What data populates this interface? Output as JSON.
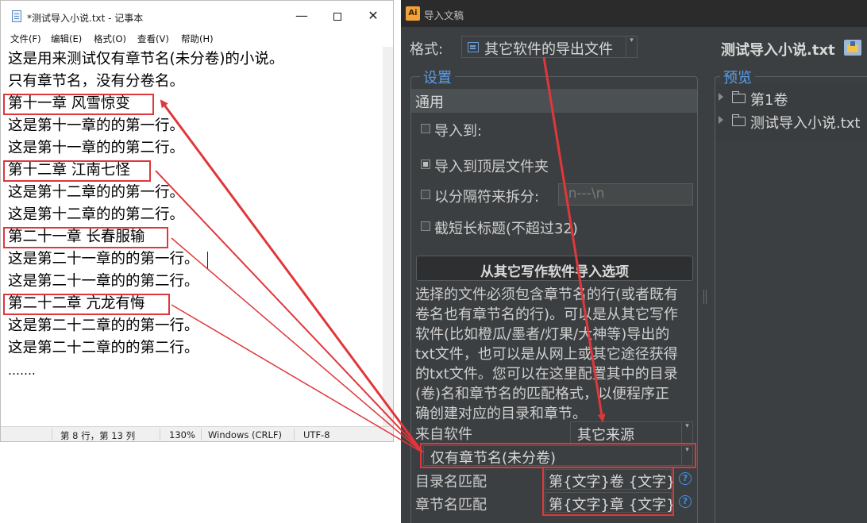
{
  "notepad": {
    "title": "*测试导入小说.txt - 记事本",
    "window_controls": {
      "minimize": "—",
      "close": "✕"
    },
    "menu": [
      "文件(F)",
      "编辑(E)",
      "格式(O)",
      "查看(V)",
      "帮助(H)"
    ],
    "lines": [
      "这是用来测试仅有章节名(未分卷)的小说。",
      "只有章节名，没有分卷名。",
      "第十一章 风雪惊变",
      "这是第十一章的的第一行。",
      "这是第十一章的的第二行。",
      "第十二章 江南七怪",
      "这是第十二章的的第一行。",
      "这是第十二章的的第二行。",
      "第二十一章 长春服输",
      "这是第二十一章的的第一行。",
      "这是第二十一章的的第二行。",
      "第二十二章 亢龙有悔",
      "这是第二十二章的的第一行。",
      "这是第二十二章的的第二行。",
      "……."
    ],
    "status": {
      "position": "第 8 行，第 13 列",
      "zoom": "130%",
      "line_ending": "Windows (CRLF)",
      "encoding": "UTF-8"
    }
  },
  "import_dialog": {
    "app_icon": "Ai",
    "title": "导入文稿",
    "format_label": "格式:",
    "format_value": "其它软件的导出文件",
    "settings_legend": "设置",
    "tab_general": "通用",
    "import_to_label": "导入到:",
    "import_top_label": "导入到顶层文件夹",
    "split_label": "以分隔符来拆分:",
    "split_placeholder": "\\n---\\n",
    "truncate_label": "截短长标题(不超过32)",
    "checkboxes": {
      "import_to": false,
      "import_top": true,
      "split": false,
      "truncate": false
    },
    "other_software_button": "从其它写作软件导入选项",
    "description_lines": [
      "选择的文件必须包含章节名的行(或者既有",
      "卷名也有章节名的行)。可以是从其它写作",
      "软件(比如橙瓜/墨者/灯果/大神等)导出的",
      "txt文件，也可以是从网上或其它途径获得",
      "的txt文件。您可以在这里配置其中的目录",
      "(卷)名和章节名的匹配格式，以便程序正",
      "确创建对应的目录和章节。"
    ],
    "source_label": "来自软件",
    "source_value": "其它来源",
    "type_value": "仅有章节名(未分卷)",
    "dir_match_label": "目录名匹配",
    "dir_match_value": "第{文字}卷 {文字}",
    "chapter_match_label": "章节名匹配",
    "chapter_match_value": "第{文字}章 {文字}",
    "help_glyph": "?",
    "file_title": "测试导入小说.txt",
    "preview_legend": "预览",
    "preview_tree": [
      "第1卷",
      "测试导入小说.txt"
    ]
  },
  "colors": {
    "annotation_red": "#e0373b",
    "dialog_bg": "#3c3f41",
    "accent_blue": "#5a9ee8"
  }
}
